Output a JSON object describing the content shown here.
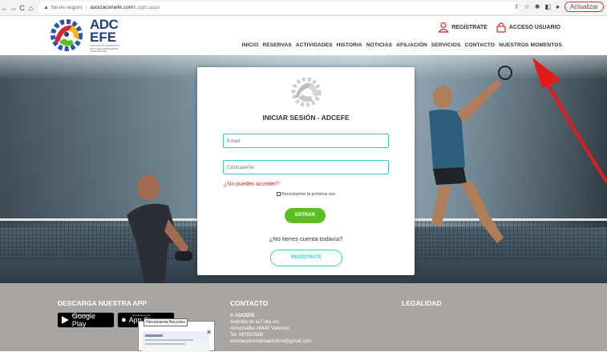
{
  "browser": {
    "security_label": "No es seguro",
    "url_host": "asociacionefe.com",
    "url_path": "/Login.aspx",
    "update_label": "Actualizar"
  },
  "brand": {
    "line1": "ADC",
    "line2": "EFE",
    "tagline": "ASOCIACIÓN DEPORTIVA CULTURAL EMPLEADOS FORD ESPAÑA"
  },
  "auth": {
    "register": "REGÍSTRATE",
    "access": "ACCESO USUARIO"
  },
  "menu": [
    "INICIO",
    "RESERVAS",
    "ACTIVIDADES",
    "HISTORIA",
    "NOTICIAS",
    "AFILIACIÓN",
    "SERVICIOS",
    "CONTACTO",
    "NUESTROS MOMENTOS"
  ],
  "login": {
    "title": "INICIAR SESIÓN - ADCEFE",
    "email_placeholder": "Email",
    "password_placeholder": "Contraseña",
    "forgot": "¿No puedes acceder?",
    "remember": "Recordarme la próxima vez",
    "submit": "ENTRAR",
    "no_account": "¿No tienes cuenta todavía?",
    "register": "REGÍSTRATE"
  },
  "footer": {
    "app_heading": "DESCARGA NUESTRA APP",
    "google_small": "DISPONIBLE EN",
    "google_big": "Google Play",
    "apple_small": "Download on the",
    "apple_big": "App Store",
    "contact_heading": "CONTACTO",
    "contact_name": "© ADCEFE",
    "contact_address1": "Avenida de la Folla s/n.",
    "contact_address2": "Almussafes 46440 Valencia",
    "contact_phone": "Tel. 697857688",
    "contact_email": "asociacionempleadosford@gmail.com",
    "legal_heading": "LEGALIDAD"
  },
  "snip_tool": {
    "tooltip": "Herramienta Recortes"
  },
  "colors": {
    "accent_teal": "#3fc7c2",
    "accent_green": "#5bbf21",
    "accent_red": "#d9262d",
    "brand_blue": "#1f3f7a"
  }
}
